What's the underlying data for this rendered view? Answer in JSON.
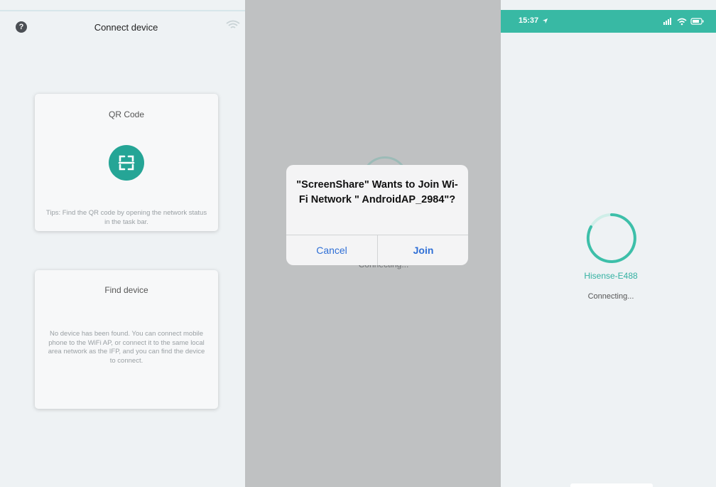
{
  "panel1": {
    "title": "Connect device",
    "help_glyph": "?",
    "qr_card": {
      "title": "QR Code",
      "tip": "Tips: Find the QR code by opening the network status in the task bar."
    },
    "find_card": {
      "title": "Find device",
      "description": "No device has been found. You can connect mobile phone to the WiFi AP, or connect it to the same local area network as the IFP, and you can find the device to connect."
    }
  },
  "panel2": {
    "background_text": "Connecting...",
    "dialog": {
      "message": "\"ScreenShare\" Wants to Join Wi-Fi Network \" AndroidAP_2984\"?",
      "cancel_label": "Cancel",
      "join_label": "Join"
    }
  },
  "panel3": {
    "status_time": "15:37",
    "device_name": "Hisense-E488",
    "status": "Connecting..."
  },
  "colors": {
    "accent": "#25a596",
    "status_bar": "#38b9a4",
    "ios_blue": "#2f6fd6",
    "panel_bg": "#eef2f4",
    "overlay_bg": "#bfc1c2"
  },
  "icons": [
    "help-icon",
    "wifi-icon",
    "qr-scan-icon",
    "location-arrow-icon",
    "signal-icon",
    "battery-icon",
    "loading-spinner-icon"
  ]
}
